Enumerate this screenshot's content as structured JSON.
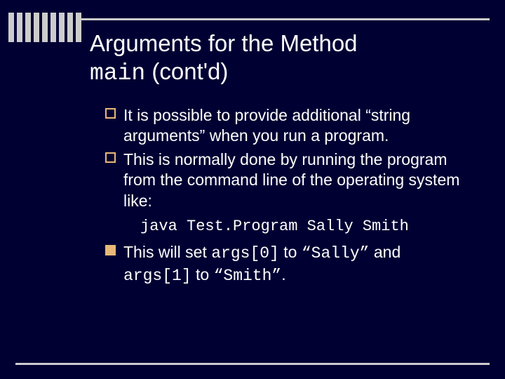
{
  "title": {
    "line1": "Arguments for the Method",
    "mono": "main",
    "tail": " (cont'd)"
  },
  "bullets": {
    "b1": "It is possible to provide additional “string arguments” when you run a program.",
    "b2": "This is normally done by running the program from the command line of the operating system like:",
    "code": "java Test.Program Sally Smith",
    "b3_pre": "This will set ",
    "b3_c1": "args[0]",
    "b3_mid1": " to ",
    "b3_q1": "“Sally”",
    "b3_mid2": " and ",
    "b3_c2": "args[1]",
    "b3_mid3": " to ",
    "b3_q2": "“Smith”",
    "b3_end": "."
  }
}
